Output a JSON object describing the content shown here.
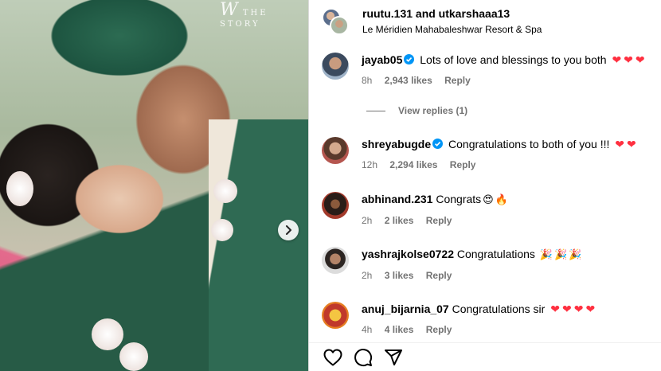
{
  "photo": {
    "watermark_letter": "W",
    "watermark_text": "THE  STORY"
  },
  "post": {
    "owners": "ruutu.131 and utkarshaaa13",
    "location": "Le Méridien Mahabaleshwar Resort & Spa"
  },
  "comments": [
    {
      "username": "jayab05",
      "verified": true,
      "text": "Lots of love and blessings to you both",
      "emojis": [
        "❤",
        "❤",
        "❤"
      ],
      "time": "8h",
      "likes": "2,943 likes",
      "reply": "Reply"
    },
    {
      "username": "shreyabugde",
      "verified": true,
      "text": "Congratulations to both of you !!!",
      "emojis": [
        "❤",
        "❤"
      ],
      "time": "12h",
      "likes": "2,294 likes",
      "reply": "Reply"
    },
    {
      "username": "abhinand.231",
      "verified": false,
      "text": "Congrats",
      "emojis": [
        "😍",
        "🔥"
      ],
      "time": "2h",
      "likes": "2 likes",
      "reply": "Reply"
    },
    {
      "username": "yashrajkolse0722",
      "verified": false,
      "text": "Congratulations",
      "emojis": [
        "🎉",
        "🎉",
        "🎉"
      ],
      "time": "2h",
      "likes": "3 likes",
      "reply": "Reply"
    },
    {
      "username": "anuj_bijarnia_07",
      "verified": false,
      "text": "Congratulations sir",
      "emojis": [
        "❤",
        "❤",
        "❤",
        "❤"
      ],
      "time": "4h",
      "likes": "4 likes",
      "reply": "Reply"
    }
  ],
  "view_replies": "View replies (1)",
  "colors": {
    "verified": "#0095f6",
    "heart": "#ff3040",
    "muted": "#737373"
  },
  "icons": {
    "like": "heart-outline-icon",
    "comment": "comment-bubble-icon",
    "share": "paper-plane-icon",
    "next": "chevron-right-icon"
  }
}
